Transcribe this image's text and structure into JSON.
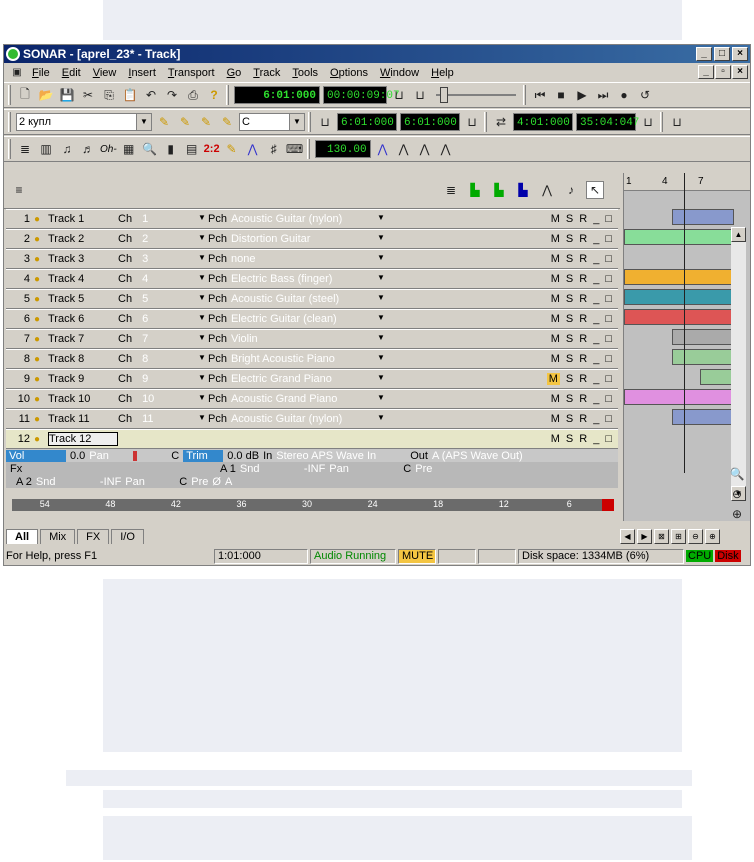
{
  "app": {
    "title": "SONAR - [aprel_23* - Track]"
  },
  "menu": [
    "File",
    "Edit",
    "View",
    "Insert",
    "Transport",
    "Go",
    "Track",
    "Tools",
    "Options",
    "Window",
    "Help"
  ],
  "toolbar1": {
    "now_time": "6:01:000",
    "smpte": "00:00:09:07"
  },
  "toolbar2": {
    "preset": "2 купл",
    "key": "C",
    "from": "6:01:000",
    "thru": "6:01:000",
    "loop_start": "4:01:000",
    "loop_end": "35:04:047"
  },
  "toolbar3": {
    "tempo": "130.00",
    "ohm": "Oh-",
    "r22": "2:2"
  },
  "tracks": [
    {
      "num": "1",
      "name": "Track 1",
      "ch": "1",
      "patch": "Acoustic Guitar (nylon)"
    },
    {
      "num": "2",
      "name": "Track 2",
      "ch": "2",
      "patch": "Distortion Guitar"
    },
    {
      "num": "3",
      "name": "Track 3",
      "ch": "3",
      "patch": "none"
    },
    {
      "num": "4",
      "name": "Track 4",
      "ch": "4",
      "patch": "Electric Bass (finger)"
    },
    {
      "num": "5",
      "name": "Track 5",
      "ch": "5",
      "patch": "Acoustic Guitar (steel)"
    },
    {
      "num": "6",
      "name": "Track 6",
      "ch": "6",
      "patch": "Electric Guitar (clean)"
    },
    {
      "num": "7",
      "name": "Track 7",
      "ch": "7",
      "patch": "Violin"
    },
    {
      "num": "8",
      "name": "Track 8",
      "ch": "8",
      "patch": "Bright Acoustic Piano"
    },
    {
      "num": "9",
      "name": "Track 9",
      "ch": "9",
      "patch": "Electric Grand Piano"
    },
    {
      "num": "10",
      "name": "Track 10",
      "ch": "10",
      "patch": "Acoustic Grand Piano"
    },
    {
      "num": "11",
      "name": "Track 11",
      "ch": "11",
      "patch": "Acoustic Guitar (nylon)"
    },
    {
      "num": "12",
      "name": "Track 12",
      "ch": "",
      "patch": ""
    }
  ],
  "labels": {
    "ch": "Ch",
    "pch": "Pch",
    "m": "M",
    "s": "S",
    "r": "R"
  },
  "strip": {
    "vol_label": "Vol",
    "vol": "0.0",
    "pan_label": "Pan",
    "pan": "C",
    "trim_label": "Trim",
    "trim": "0.0 dB",
    "in_label": "In",
    "in": "Stereo APS Wave In",
    "out_label": "Out",
    "out": "A (APS Wave Out)",
    "fx": "Fx",
    "send1": "A 1",
    "snd": "Snd",
    "inf": "-INF",
    "pan2": "Pan",
    "c": "C",
    "pre": "Pre",
    "send2": "A 2",
    "phase": "Ø",
    "a": "A"
  },
  "meter": [
    "54",
    "48",
    "42",
    "36",
    "30",
    "24",
    "18",
    "12",
    "6"
  ],
  "ruler": [
    "1",
    "4",
    "7"
  ],
  "tabs": [
    "All",
    "Mix",
    "FX",
    "I/O"
  ],
  "status": {
    "help": "For Help, press F1",
    "time": "1:01:000",
    "audio": "Audio Running",
    "mute": "MUTE",
    "disk": "Disk space: 1334MB (6%)",
    "cpu": "CPU",
    "diskmeter": "Disk"
  }
}
